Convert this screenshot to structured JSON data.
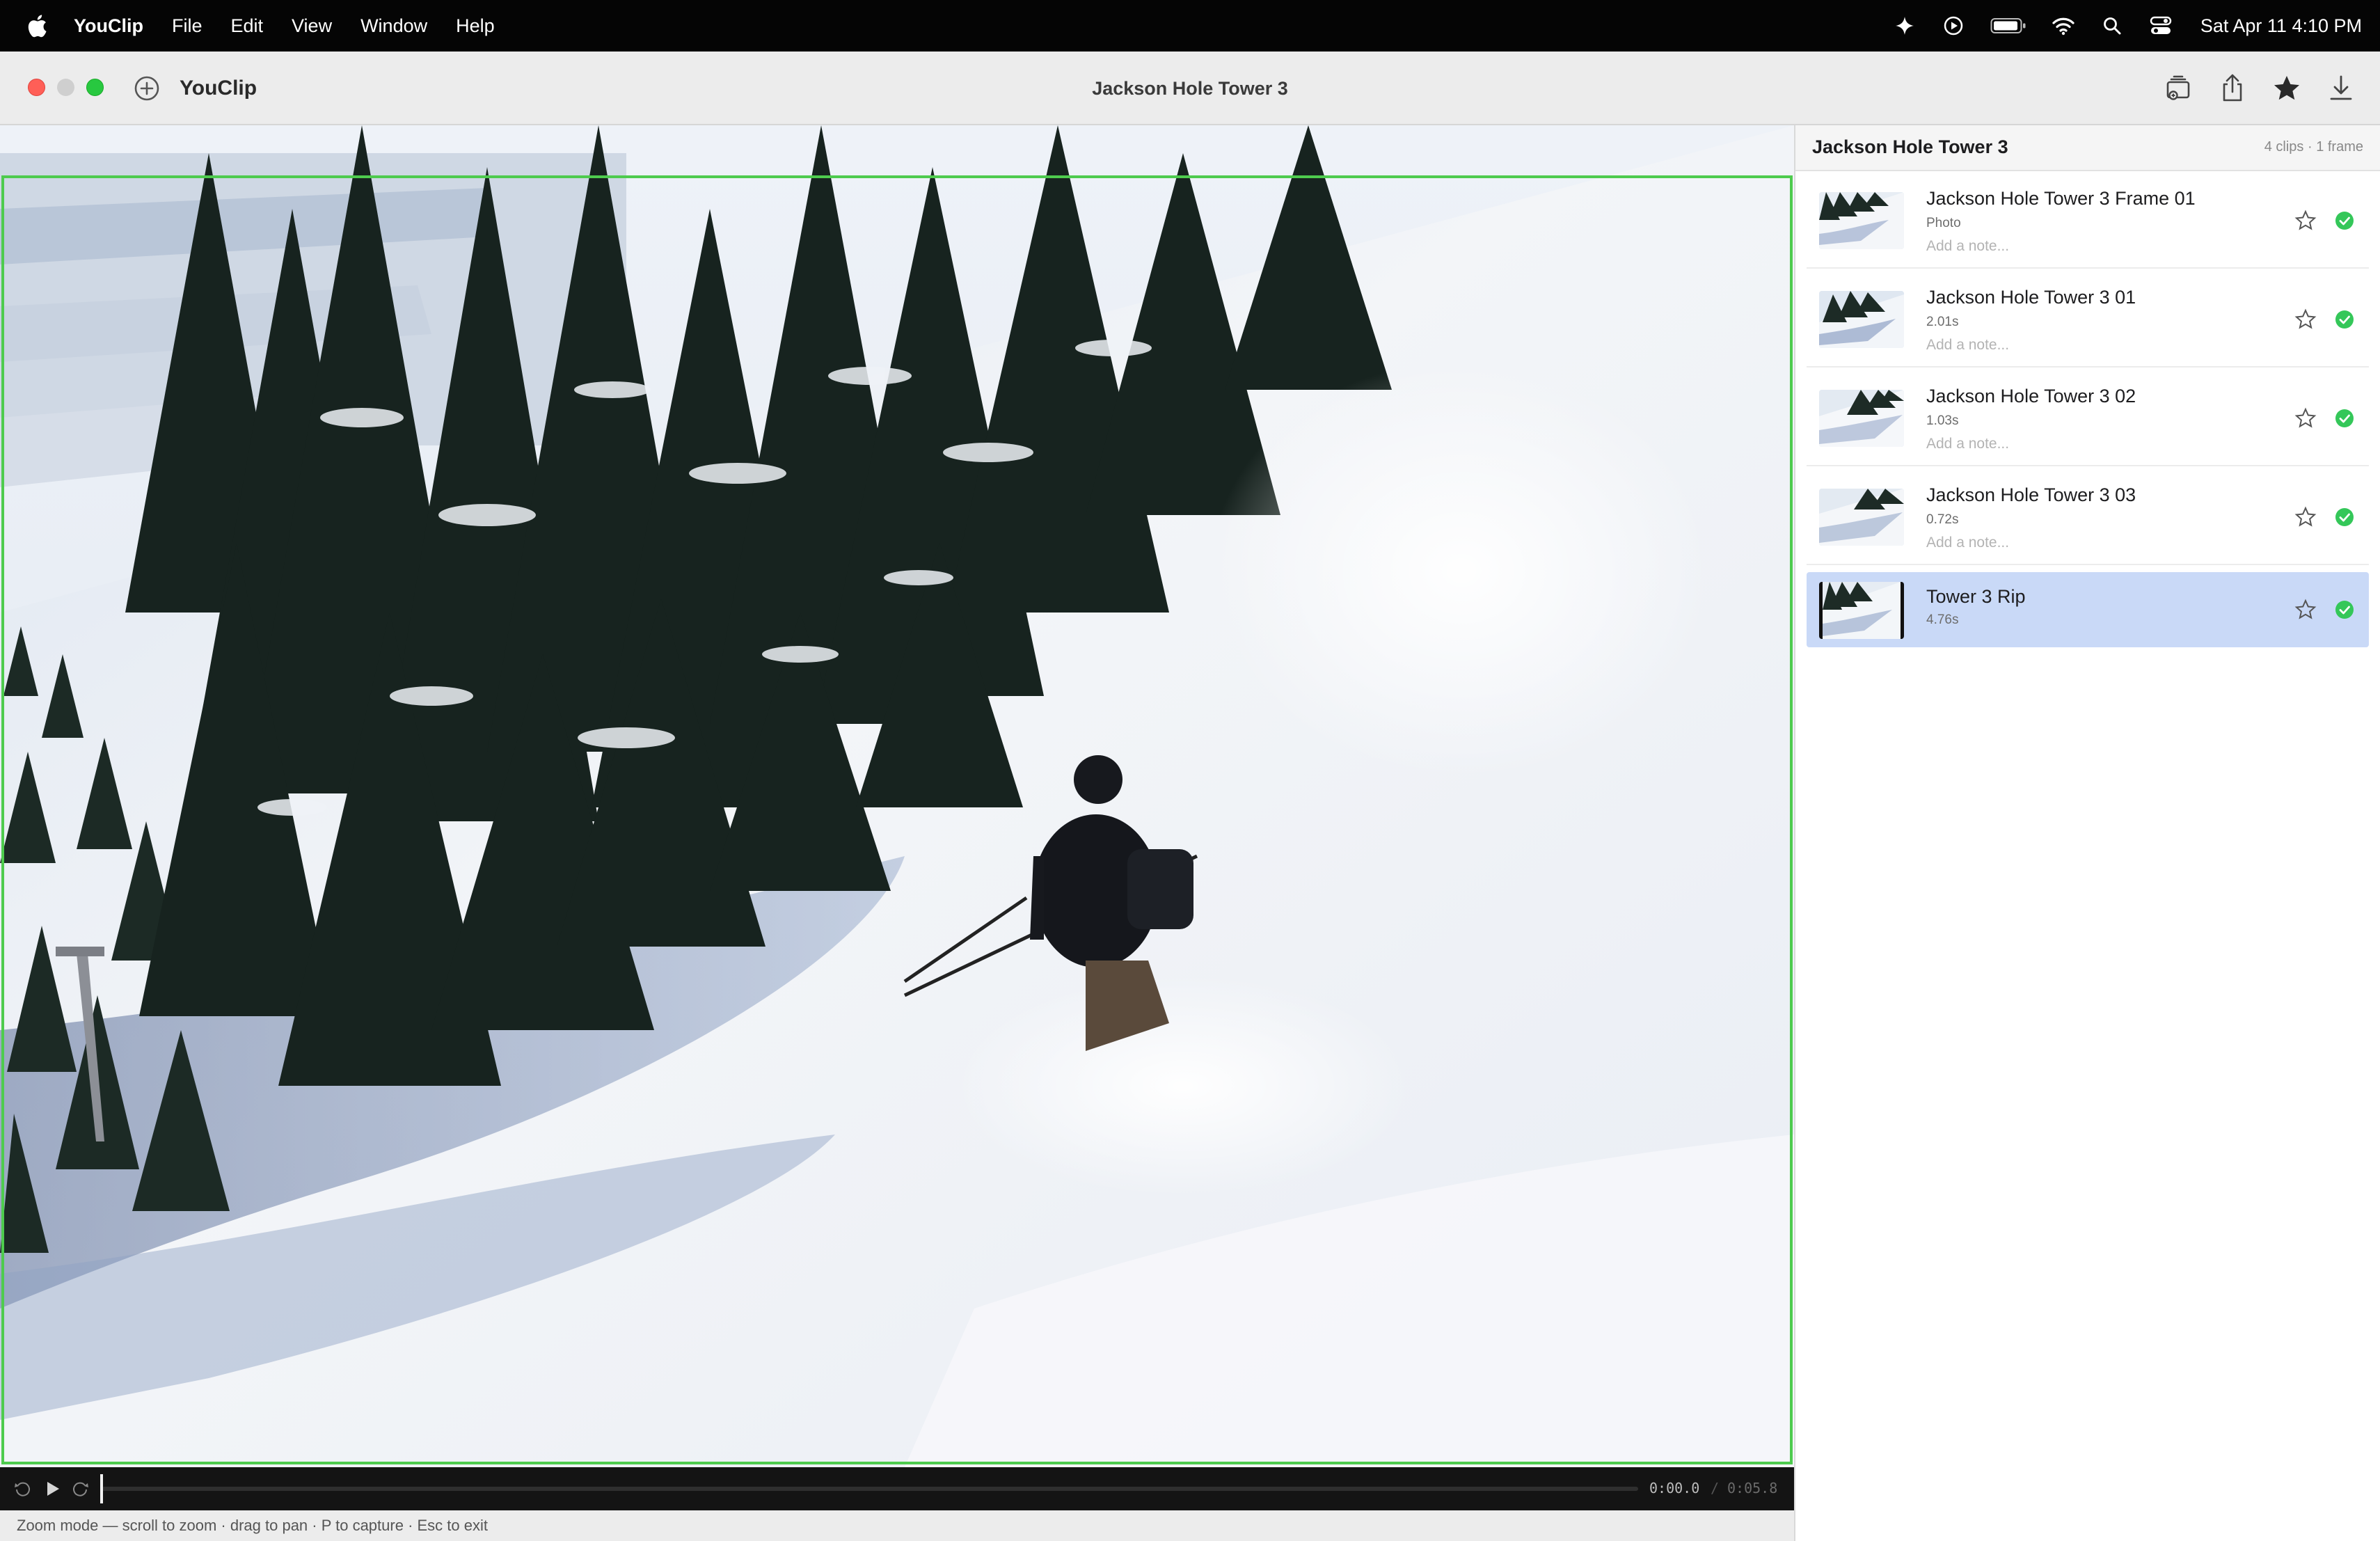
{
  "menubar": {
    "app_name": "YouClip",
    "menus": [
      "File",
      "Edit",
      "View",
      "Window",
      "Help"
    ],
    "clock": "Sat Apr 11  4:10 PM",
    "status_icons": [
      "sparkle-icon",
      "play-circle-icon",
      "battery-icon",
      "wifi-icon",
      "search-icon",
      "control-center-icon"
    ]
  },
  "window": {
    "app_label": "YouClip",
    "title": "Jackson Hole Tower 3",
    "toolbar_icons": [
      "import-icon",
      "share-icon",
      "star-icon",
      "download-icon"
    ]
  },
  "viewer": {
    "capture_outline_color": "#4ecb4e",
    "current_time": "0:00.0",
    "separator": "/",
    "duration": "0:05.8",
    "playback_position": 0.0
  },
  "status_line": "Zoom mode — scroll to zoom · drag to pan · P to capture · Esc to exit",
  "sidebar": {
    "title": "Jackson Hole Tower 3",
    "meta": "4 clips · 1 frame",
    "clips": [
      {
        "name": "Jackson Hole Tower 3 Frame 01",
        "sub": "Photo",
        "note": "Add a note...",
        "starred": false,
        "done": true
      },
      {
        "name": "Jackson Hole Tower 3 01",
        "sub": "2.01s",
        "note": "Add a note...",
        "starred": false,
        "done": true
      },
      {
        "name": "Jackson Hole Tower 3 02",
        "sub": "1.03s",
        "note": "Add a note...",
        "starred": false,
        "done": true
      },
      {
        "name": "Jackson Hole Tower 3 03",
        "sub": "0.72s",
        "note": "Add a note...",
        "starred": false,
        "done": true
      },
      {
        "name": "Tower 3 Rip",
        "sub": "4.76s",
        "note": "",
        "starred": false,
        "done": true,
        "selected": true
      }
    ],
    "selected_color": "#c9d9f7",
    "check_color": "#34c759"
  }
}
